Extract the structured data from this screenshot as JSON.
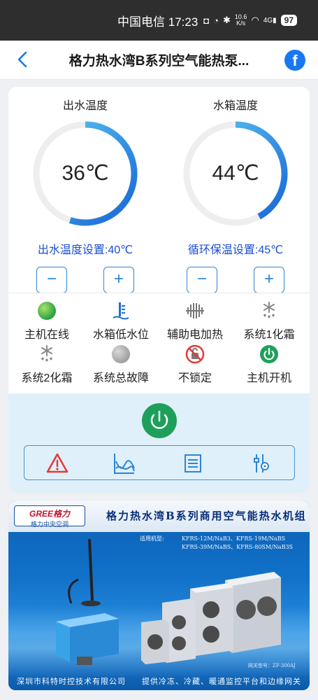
{
  "status_bar": {
    "carrier_time": "中国电信 17:23",
    "speed_value": "10.6",
    "speed_unit": "K/s",
    "network": "4G",
    "battery": "97"
  },
  "nav": {
    "title": "格力热水湾B系列空气能热泵...",
    "fb_label": "f"
  },
  "gauges": {
    "outlet": {
      "label": "出水温度",
      "value": "36℃",
      "fill_fraction": 0.55,
      "setpoint": "出水温度设置:40℃",
      "minus": "−",
      "plus": "+"
    },
    "tank": {
      "label": "水箱温度",
      "value": "44℃",
      "fill_fraction": 0.42,
      "setpoint": "循环保温设置:45℃",
      "minus": "−",
      "plus": "+"
    }
  },
  "status_items": [
    {
      "label": "主机在线",
      "icon": "online-indicator-icon"
    },
    {
      "label": "水箱低水位",
      "icon": "water-level-icon"
    },
    {
      "label": "辅助电加热",
      "icon": "electric-heater-icon"
    },
    {
      "label": "系统1化霜",
      "icon": "defrost-icon"
    },
    {
      "label": "系统2化霜",
      "icon": "defrost-icon"
    },
    {
      "label": "系统总故障",
      "icon": "fault-indicator-icon"
    },
    {
      "label": "不锁定",
      "icon": "unlocked-icon"
    },
    {
      "label": "主机开机",
      "icon": "power-on-icon"
    }
  ],
  "toolbar": {
    "items": [
      "warning-icon",
      "chart-icon",
      "list-icon",
      "settings-sliders-icon"
    ]
  },
  "banner": {
    "logo_top": "GREE格力",
    "logo_bottom": "格力中央空调",
    "title": "格力热水湾B系列商用空气能热水机组",
    "models_label": "适用机型:",
    "models_line1": "KFRS-12M/NaB3、KFRS-19M/NaBS",
    "models_line2": "KFRS-39M/NaBS、KFRS-80SM/NaB3S",
    "ref": "网关型号：ZF-300AJ",
    "footer_left": "深圳市科特时控技术有限公司",
    "footer_right": "提供冷冻、冷藏、暖通监控平台和边缘网关"
  },
  "colors": {
    "accent": "#1677e0",
    "gauge_start": "#1565d8",
    "gauge_end": "#5ec8f2",
    "setpoint_text": "#1a4fd1",
    "online_green": "#1ea05a",
    "panel_bg": "#dff0fb",
    "fault_gray": "#9e9e9e",
    "warning_red": "#e53935"
  }
}
